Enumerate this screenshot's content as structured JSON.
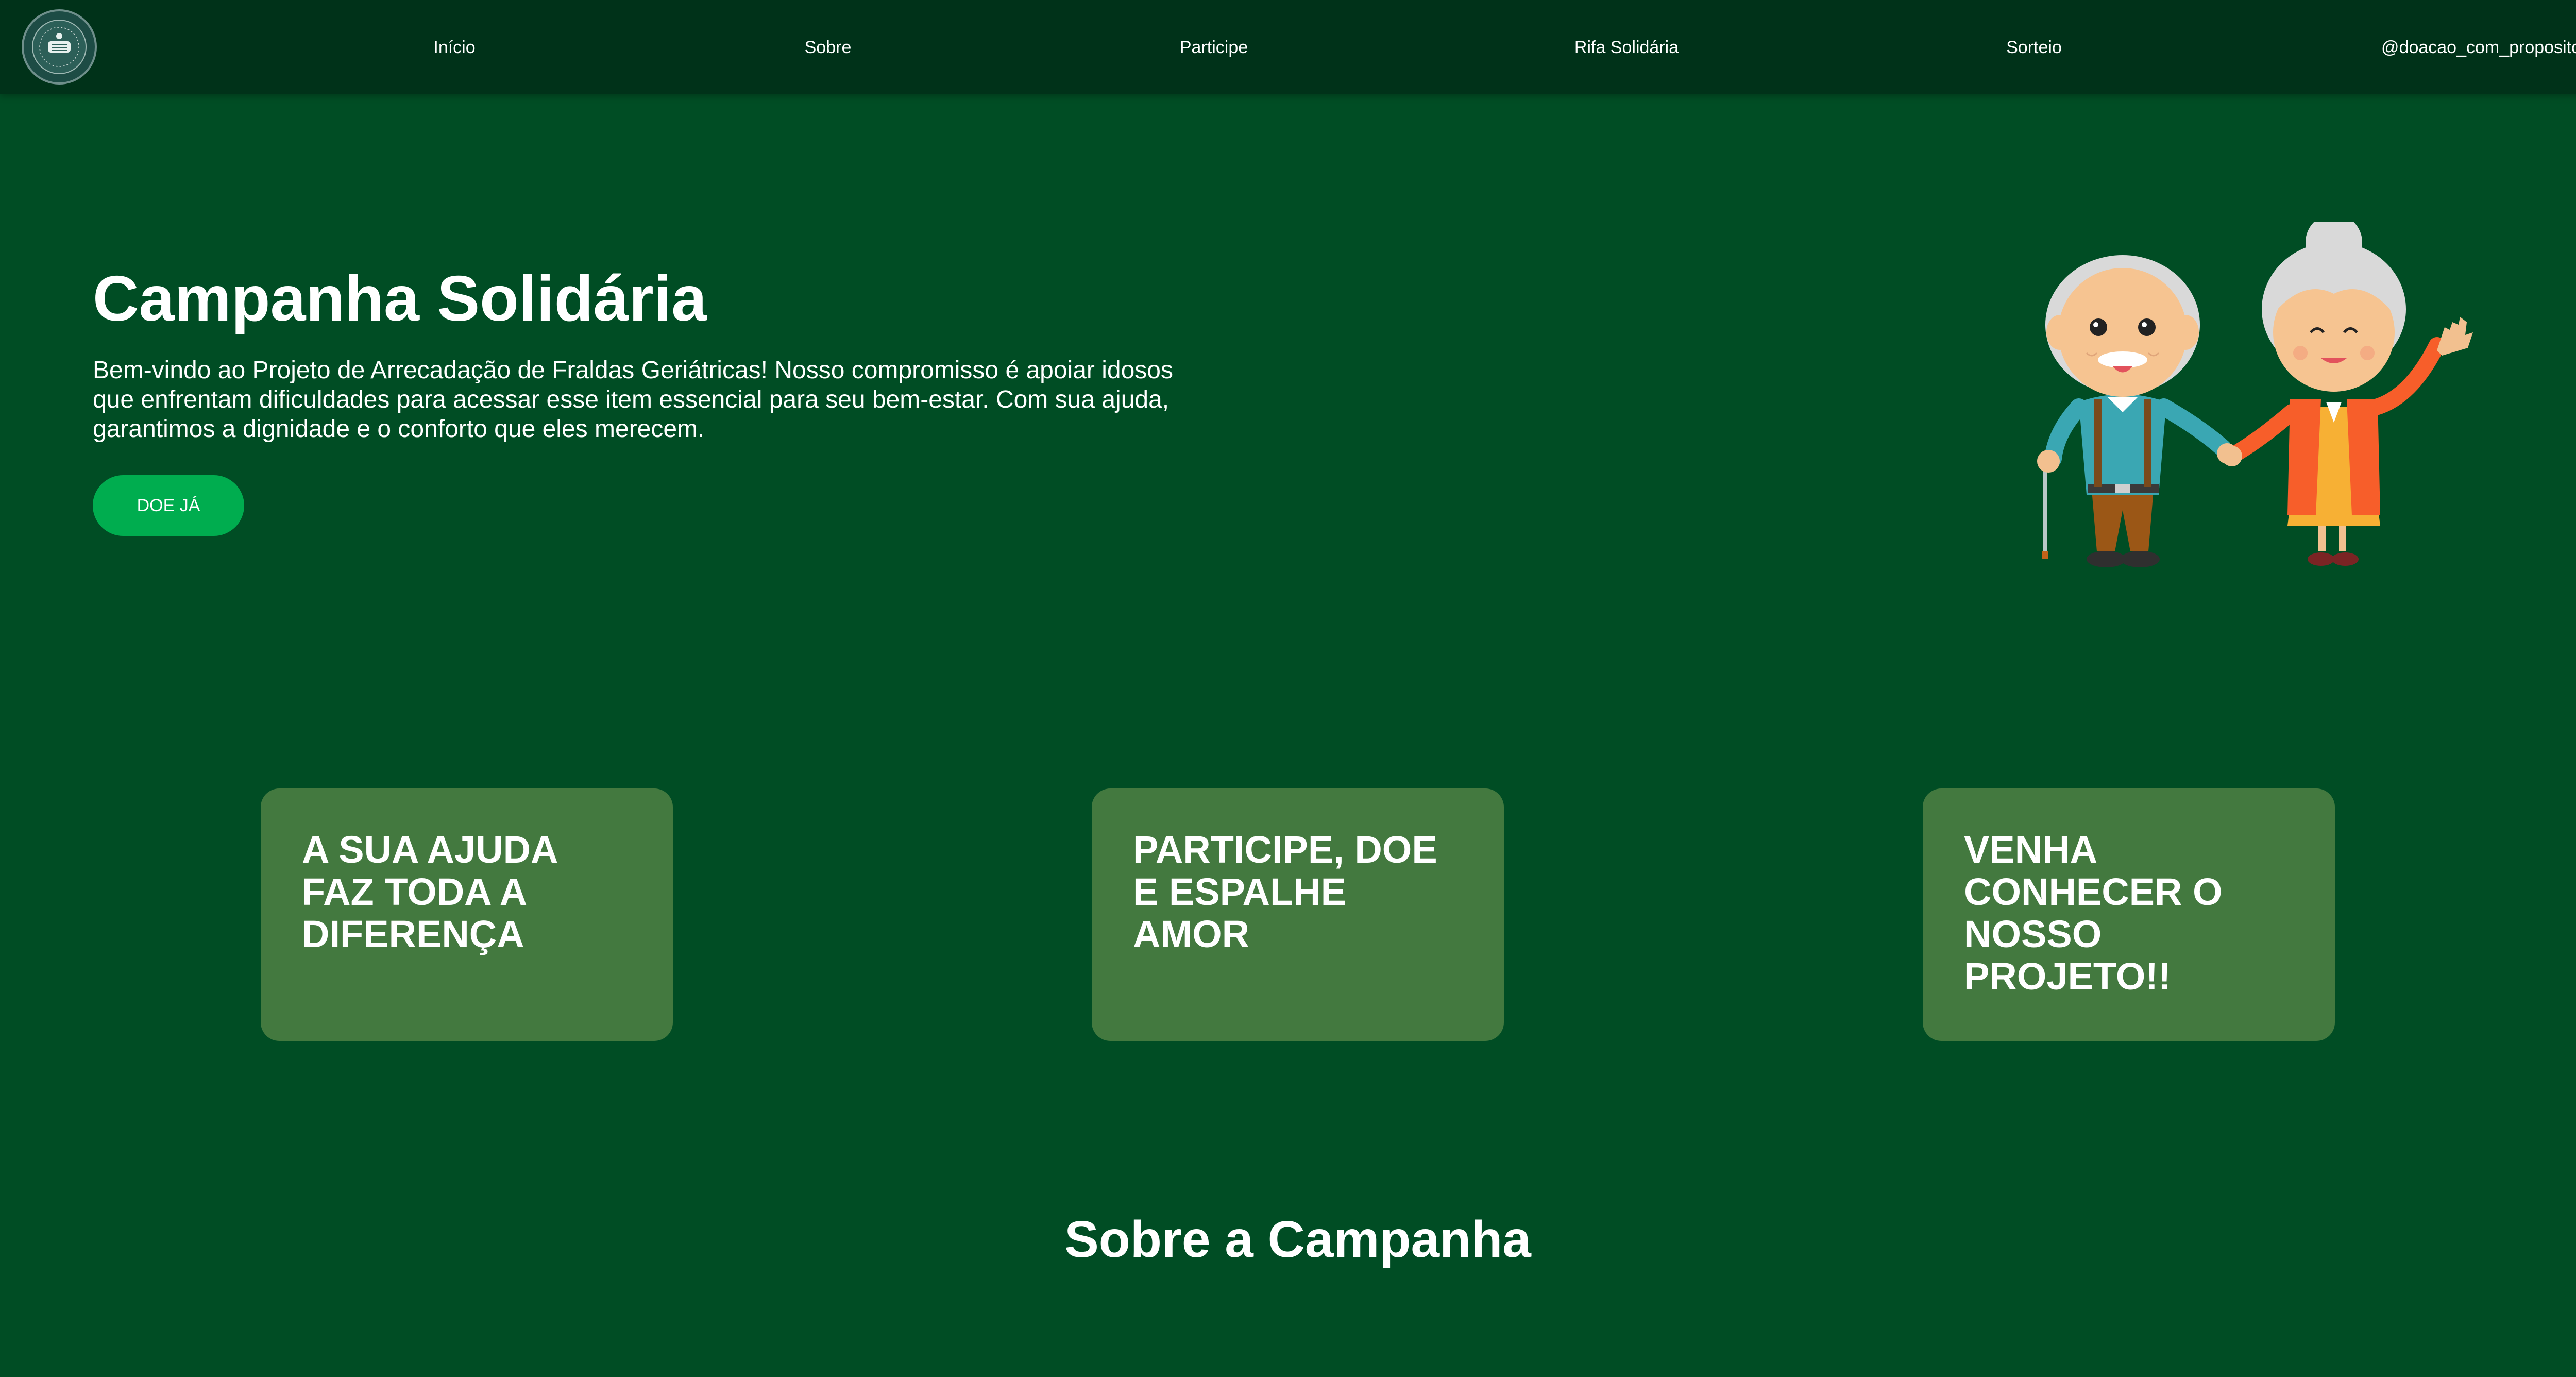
{
  "nav": {
    "links": [
      {
        "label": "Início"
      },
      {
        "label": "Sobre"
      },
      {
        "label": "Participe"
      },
      {
        "label": "Rifa Solidária"
      },
      {
        "label": "Sorteio"
      },
      {
        "label": "@doacao_com_proposito"
      }
    ]
  },
  "hero": {
    "title": "Campanha Solidária",
    "text": "Bem-vindo ao Projeto de Arrecadação de Fraldas Geriátricas! Nosso compromisso é apoiar idosos que enfrentam dificuldades para acessar esse item essencial para seu bem-estar. Com sua ajuda, garantimos a dignidade e o conforto que eles merecem.",
    "button_label": "DOE JÁ"
  },
  "cards": [
    {
      "text": "A SUA AJUDA FAZ TODA A DIFERENÇA"
    },
    {
      "text": "PARTICIPE, DOE E ESPALHE AMOR"
    },
    {
      "text": "VENHA CONHECER O NOSSO PROJETO!!"
    }
  ],
  "about": {
    "title": "Sobre a Campanha"
  },
  "colors": {
    "background": "#004d24",
    "navbar": "#003219",
    "button": "#00ad4f",
    "card": "#43793f"
  }
}
